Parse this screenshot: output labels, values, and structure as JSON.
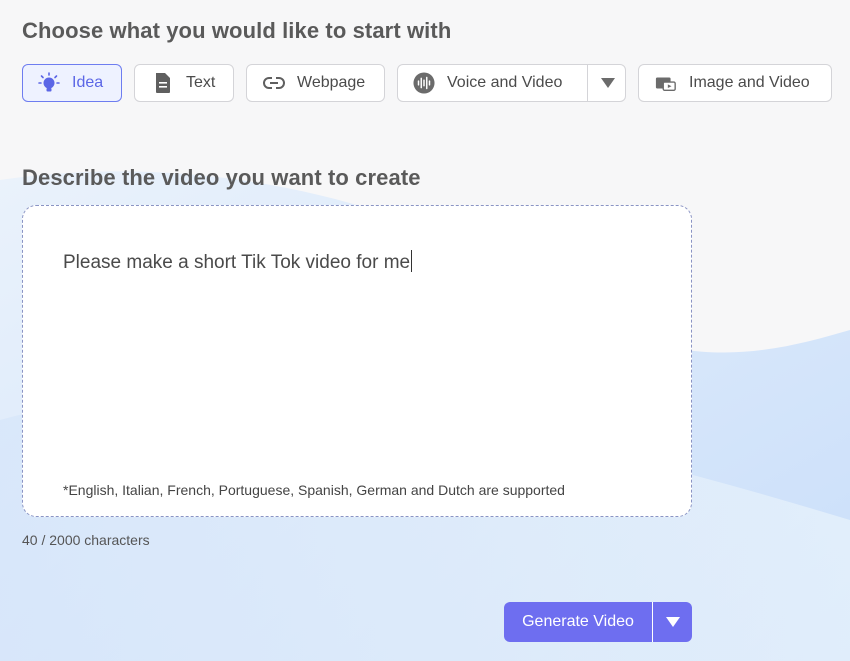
{
  "headings": {
    "choose": "Choose what you would like to start with",
    "describe": "Describe the video you want to create"
  },
  "options": [
    {
      "label": "Idea",
      "icon": "lightbulb-icon",
      "active": true
    },
    {
      "label": "Text",
      "icon": "document-icon",
      "active": false
    },
    {
      "label": "Webpage",
      "icon": "link-icon",
      "active": false
    },
    {
      "label": "Voice and Video",
      "icon": "audio-wave-icon",
      "active": false,
      "has_dropdown": true
    },
    {
      "label": "Image and Video",
      "icon": "image-video-icon",
      "active": false
    }
  ],
  "prompt": {
    "value": "Please make a short Tik Tok video for me",
    "note": "*English, Italian, French, Portuguese, Spanish, German and Dutch are supported"
  },
  "counter": "40 / 2000 characters",
  "generate": {
    "label": "Generate Video"
  },
  "colors": {
    "accent": "#6e6ef0",
    "active_bg": "#eef2ff",
    "active_border": "#6e7df0"
  }
}
